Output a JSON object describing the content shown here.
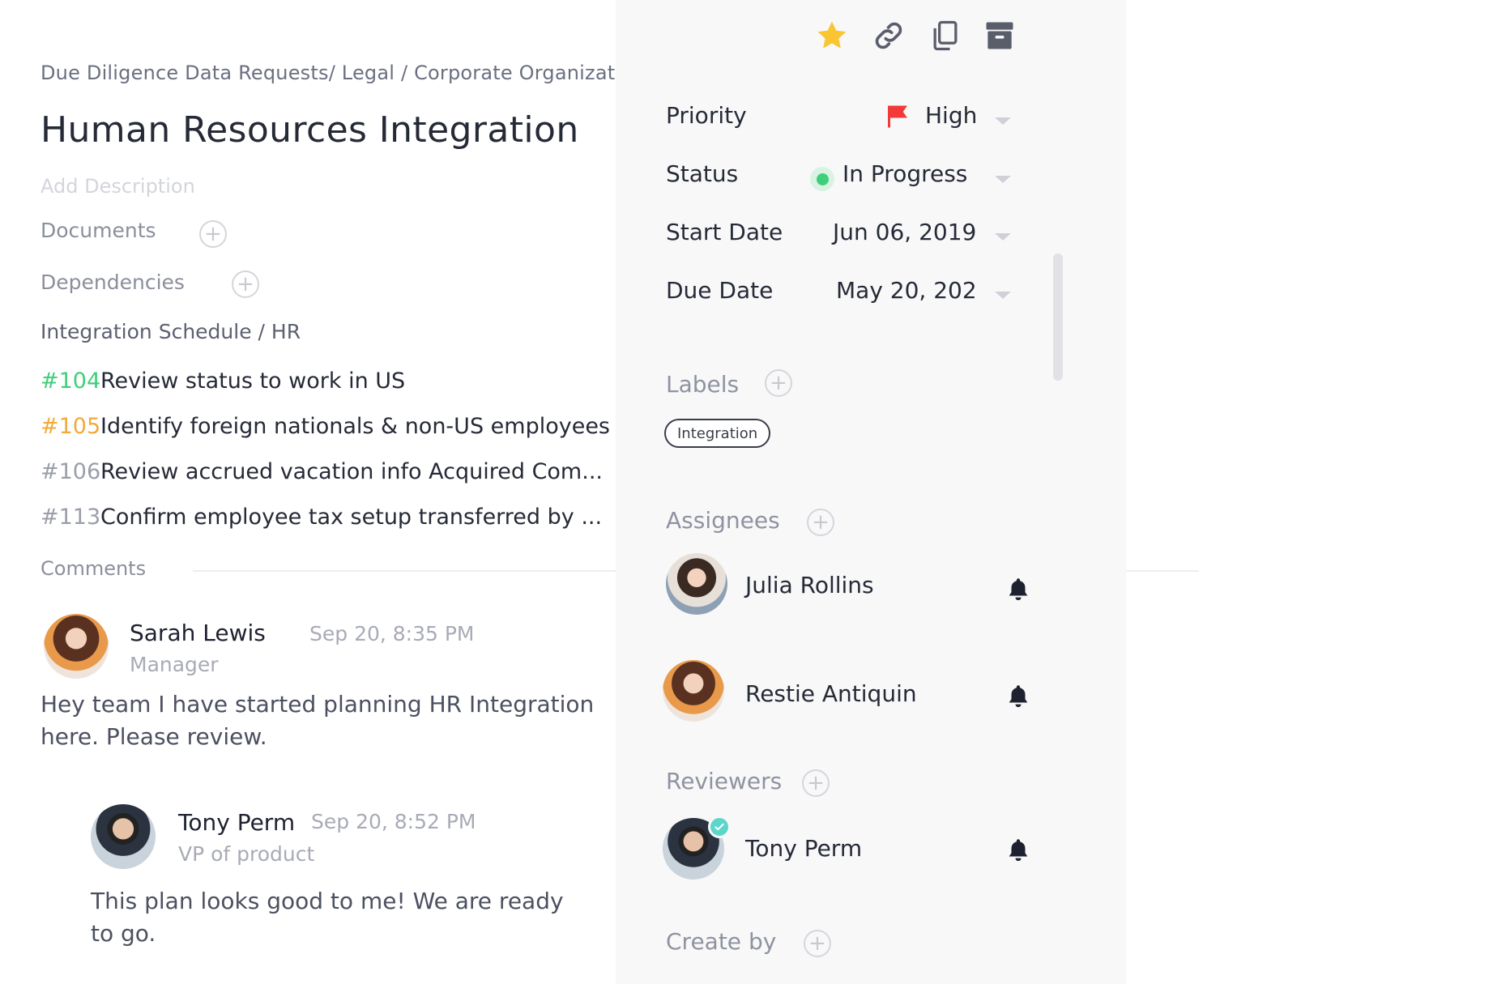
{
  "breadcrumb": "Due Diligence Data Requests/ Legal / Corporate Organizatio",
  "task": {
    "title": "Human Resources Integration",
    "add_description": "Add Description"
  },
  "sections": {
    "documents": "Documents",
    "dependencies": "Dependencies",
    "schedule": "Integration Schedule / HR",
    "comments": "Comments"
  },
  "subtasks": [
    {
      "num": "#104",
      "title": "Review status to work in US",
      "color": "#3ecf7a"
    },
    {
      "num": "#105",
      "title": "Identify foreign nationals & non-US employees",
      "color": "#f3a937"
    },
    {
      "num": "#106",
      "title": "Review accrued vacation info Acquired Com...",
      "color": "#9a9ea9"
    },
    {
      "num": "#113",
      "title": "Confirm employee tax setup transferred by ...",
      "color": "#9a9ea9"
    }
  ],
  "comments": [
    {
      "name": "Sarah Lewis",
      "time": "Sep 20, 8:35 PM",
      "role": "Manager",
      "body_line1": "Hey team I have started planning HR Integration",
      "body_line2": "here. Please review."
    },
    {
      "name": "Tony Perm",
      "time": "Sep 20, 8:52 PM",
      "role": "VP of product",
      "body_line1": "This plan looks good to me! We are ready",
      "body_line2": "to go."
    }
  ],
  "toolbar": {
    "star": "star-icon",
    "link": "link-icon",
    "copy": "copy-icon",
    "archive": "archive-icon"
  },
  "properties": {
    "priority": {
      "label": "Priority",
      "value": "High",
      "flag_color": "#f23a3a"
    },
    "status": {
      "label": "Status",
      "value": "In Progress",
      "dot_color": "#3ecf7a"
    },
    "start_date": {
      "label": "Start Date",
      "value": "Jun 06, 2019"
    },
    "due_date": {
      "label": "Due Date",
      "value": "May 20, 202"
    }
  },
  "labels": {
    "title": "Labels",
    "items": [
      "Integration"
    ]
  },
  "assignees": {
    "title": "Assignees",
    "people": [
      "Julia Rollins",
      "Restie Antiquin"
    ]
  },
  "reviewers": {
    "title": "Reviewers",
    "people": [
      "Tony Perm"
    ]
  },
  "create_by": {
    "title": "Create by"
  },
  "colors": {
    "star": "#f9c531",
    "accent_green": "#3ecf7a",
    "accent_orange": "#f3a937",
    "verified": "#5cd6c9"
  }
}
